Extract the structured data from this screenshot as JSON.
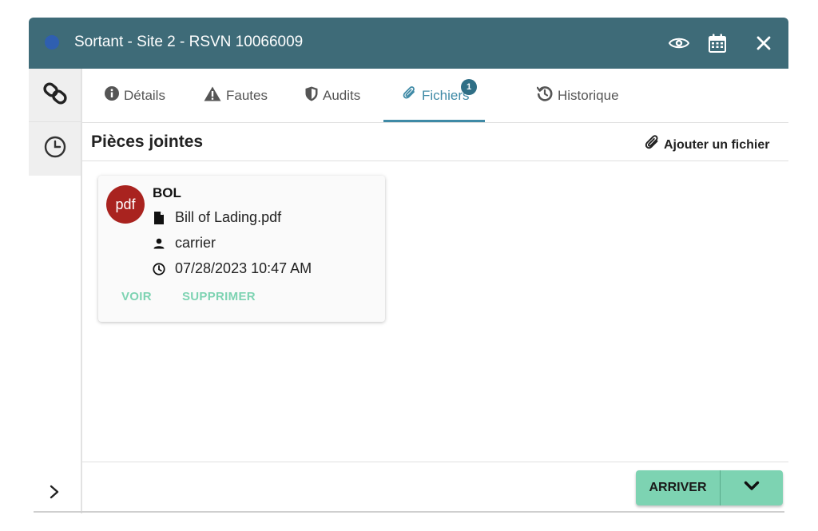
{
  "window": {
    "title": "Sortant - Site 2 - RSVN 10066009",
    "header_color": "#3e6b78",
    "status_dot_color": "#2f5fb0",
    "header_icons": [
      "eye-icon",
      "calendar-icon",
      "close-icon"
    ]
  },
  "rail": {
    "items": [
      {
        "icon": "link-icon"
      },
      {
        "icon": "clock-icon"
      }
    ],
    "expand_icon": "chevron-right-icon"
  },
  "tabs": [
    {
      "label": "Détails",
      "icon": "info-icon",
      "active": false
    },
    {
      "label": "Fautes",
      "icon": "warning-icon",
      "active": false
    },
    {
      "label": "Audits",
      "icon": "shield-icon",
      "active": false
    },
    {
      "label": "Fichiers",
      "icon": "paperclip-icon",
      "active": true,
      "badge": "1"
    },
    {
      "label": "Historique",
      "icon": "history-icon",
      "active": false
    }
  ],
  "attachments": {
    "title": "Pièces jointes",
    "add_label": "Ajouter un fichier",
    "items": [
      {
        "avatar": "pdf",
        "title": "BOL",
        "filename": "Bill of Lading.pdf",
        "user": "carrier",
        "timestamp": "07/28/2023 10:47 AM",
        "view_label": "VOIR",
        "delete_label": "SUPPRIMER"
      }
    ]
  },
  "footer": {
    "primary_action": "ARRIVER",
    "accent_color": "#7dd3b2"
  }
}
